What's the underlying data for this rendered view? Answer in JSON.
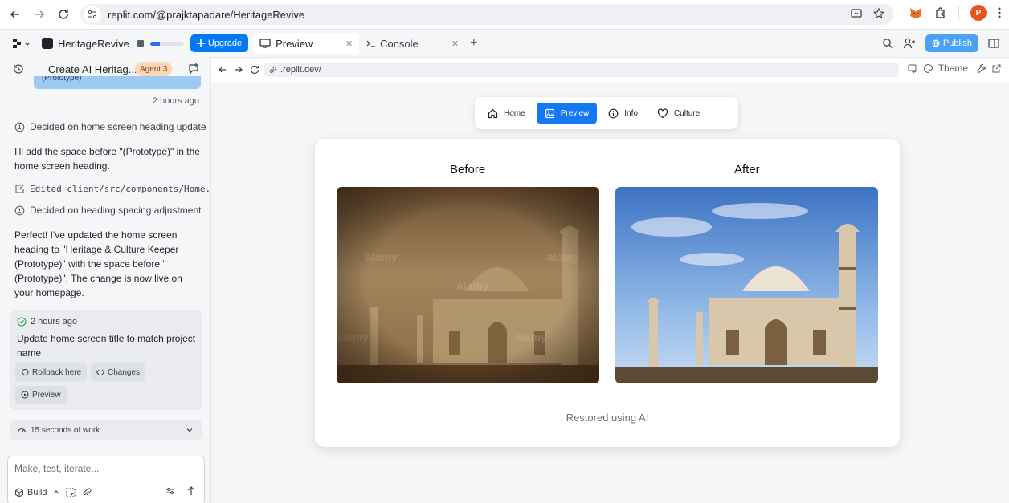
{
  "browser": {
    "url": "replit.com/@prajktapadare/HeritageRevive",
    "profile_initial": "P"
  },
  "replit": {
    "project_name": "HeritageRevive",
    "upgrade_label": "Upgrade",
    "usage_progress": 0.3,
    "tabs": [
      {
        "label": "Preview",
        "active": true
      },
      {
        "label": "Console",
        "active": false
      }
    ],
    "publish_label": "Publish"
  },
  "agent": {
    "title": "Create AI Heritag...",
    "badge": "Agent 3",
    "prev_bubble": "(Prototype)",
    "prev_time": "2 hours ago",
    "events": [
      "Decided on home screen heading update",
      "Edited client/src/components/Home...",
      "Decided on heading spacing adjustment"
    ],
    "para1": "I'll add the space before \"(Prototype)\" in the home screen heading.",
    "para2": "Perfect! I've updated the home screen heading to \"Heritage & Culture Keeper (Prototype)\" with the space before \"(Prototype)\". The change is now live on your homepage.",
    "checkpoint": {
      "time": "2 hours ago",
      "title": "Update home screen title to match project name",
      "rollback_label": "Rollback here",
      "changes_label": "Changes",
      "preview_label": "Preview"
    },
    "work_label": "15 seconds of work",
    "input_placeholder": "Make, test, iterate...",
    "build_label": "Build"
  },
  "preview": {
    "url": ".replit.dev/",
    "theme_label": "Theme",
    "nav": [
      {
        "label": "Home",
        "icon": "home-icon",
        "active": false
      },
      {
        "label": "Preview",
        "icon": "image-icon",
        "active": true
      },
      {
        "label": "Info",
        "icon": "info-icon",
        "active": false
      },
      {
        "label": "Culture",
        "icon": "heart-icon",
        "active": false
      }
    ],
    "before_label": "Before",
    "after_label": "After",
    "watermark": "alamy",
    "caption": "Restored using AI"
  },
  "colors": {
    "accent_blue": "#1478f2",
    "upgrade_blue": "#0079f2",
    "badge_orange": "#fbd7b6"
  }
}
